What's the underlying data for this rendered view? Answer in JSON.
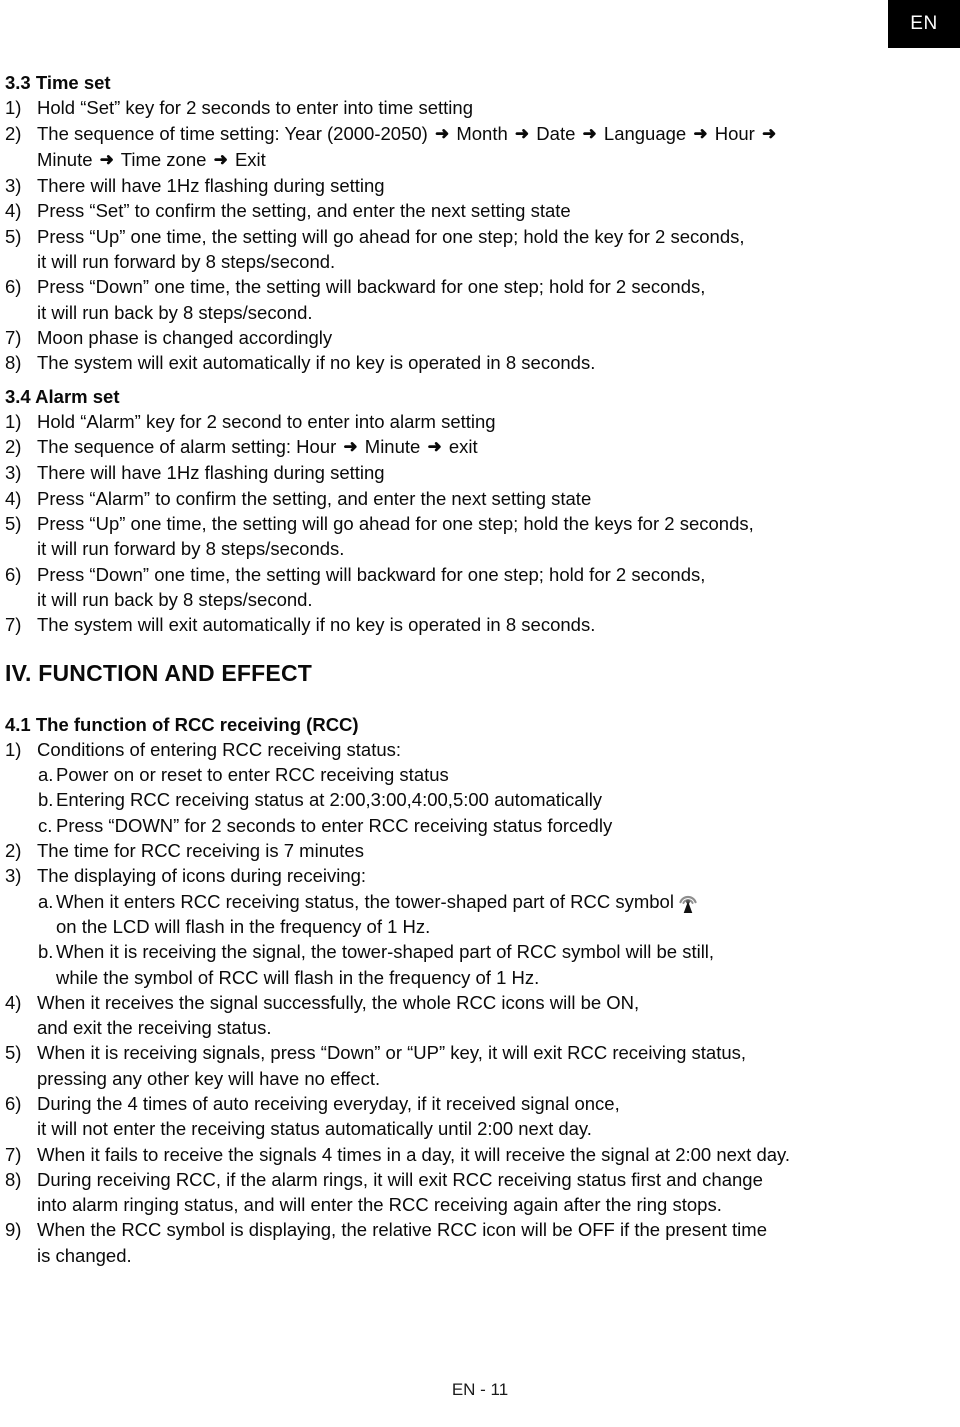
{
  "page": {
    "language_tab": "EN",
    "footer": "EN - 11"
  },
  "icons": {
    "arrow": "➜",
    "rcc_tower": "rcc-tower-icon"
  },
  "sections": [
    {
      "id": "3.3",
      "heading": "3.3 Time set",
      "items": [
        {
          "marker": "1)",
          "lines": [
            "Hold “Set” key for 2 seconds to enter into time setting"
          ]
        },
        {
          "marker": "2)",
          "lines": [
            "The sequence of time setting: Year (2000-2050) ➜ Month ➜ Date ➜ Language ➜ Hour ➜",
            "Minute ➜ Time zone ➜ Exit"
          ]
        },
        {
          "marker": "3)",
          "lines": [
            "There will have 1Hz flashing during setting"
          ]
        },
        {
          "marker": "4)",
          "lines": [
            "Press “Set” to confirm the setting, and enter the next setting state"
          ]
        },
        {
          "marker": "5)",
          "lines": [
            "Press “Up” one time, the setting will go ahead for one step; hold the key for 2 seconds,",
            "it will run forward by 8 steps/second."
          ]
        },
        {
          "marker": "6)",
          "lines": [
            "Press “Down” one time, the setting will backward for one step; hold for 2 seconds,",
            "it will run back by 8 steps/second."
          ]
        },
        {
          "marker": "7)",
          "lines": [
            "Moon phase is changed accordingly"
          ]
        },
        {
          "marker": "8)",
          "lines": [
            "The system will exit automatically if no key is operated in 8 seconds."
          ]
        }
      ]
    },
    {
      "id": "3.4",
      "heading": "3.4 Alarm set",
      "items": [
        {
          "marker": "1)",
          "lines": [
            "Hold “Alarm” key for 2 second to enter into alarm setting"
          ]
        },
        {
          "marker": "2)",
          "lines": [
            "The sequence of alarm setting: Hour ➜ Minute ➜ exit"
          ]
        },
        {
          "marker": "3)",
          "lines": [
            "There will have 1Hz flashing during setting"
          ]
        },
        {
          "marker": "4)",
          "lines": [
            "Press “Alarm” to confirm the setting, and enter the next setting state"
          ]
        },
        {
          "marker": "5)",
          "lines": [
            "Press “Up” one time, the setting will go ahead for one step; hold the keys for 2 seconds,",
            "it will run forward by 8 steps/seconds."
          ]
        },
        {
          "marker": "6)",
          "lines": [
            "Press “Down” one time, the setting will backward for one step; hold for 2 seconds,",
            "it will run back by 8 steps/second."
          ]
        },
        {
          "marker": "7)",
          "lines": [
            "The system will exit automatically if no key is operated in 8 seconds."
          ]
        }
      ]
    }
  ],
  "chapter": {
    "heading": "IV. FUNCTION AND EFFECT"
  },
  "section_41": {
    "heading": "4.1 The function of RCC receiving (RCC)",
    "items": [
      {
        "marker": "1)",
        "lines": [
          "Conditions of entering RCC receiving status:"
        ],
        "sub": [
          {
            "marker": "a.",
            "lines": [
              "Power on or reset to enter RCC receiving status"
            ]
          },
          {
            "marker": "b.",
            "lines": [
              "Entering RCC receiving status at 2:00,3:00,4:00,5:00 automatically"
            ]
          },
          {
            "marker": "c.",
            "lines": [
              "Press “DOWN” for 2 seconds to enter RCC receiving status forcedly"
            ]
          }
        ]
      },
      {
        "marker": "2)",
        "lines": [
          "The time for RCC receiving is 7 minutes"
        ]
      },
      {
        "marker": "3)",
        "lines": [
          "The displaying of icons during receiving:"
        ],
        "sub": [
          {
            "marker": "a.",
            "lines": [
              "When it enters RCC receiving status, the tower-shaped part of RCC symbol",
              "on the LCD will flash in the frequency of 1 Hz."
            ],
            "icon_after_first_line": "rcc-tower"
          },
          {
            "marker": "b.",
            "lines": [
              "When it is receiving the signal, the tower-shaped part of RCC symbol will be still,",
              "while the symbol of RCC will flash in the frequency of 1 Hz."
            ]
          }
        ]
      },
      {
        "marker": "4)",
        "lines": [
          "When it receives the signal successfully, the whole RCC icons will be ON,",
          "and exit the receiving status."
        ]
      },
      {
        "marker": "5)",
        "lines": [
          "When it is receiving signals, press “Down” or “UP” key, it will exit RCC receiving status,",
          "pressing any other key will have no effect."
        ]
      },
      {
        "marker": "6)",
        "lines": [
          "During the 4 times of auto receiving everyday, if it received signal once,",
          "it will not enter the receiving status automatically until 2:00 next day."
        ]
      },
      {
        "marker": "7)",
        "lines": [
          "When it fails to receive the signals 4 times in a day, it will receive the signal at 2:00 next day."
        ]
      },
      {
        "marker": "8)",
        "lines": [
          "During receiving RCC, if the alarm rings, it will exit RCC receiving status first and change",
          "into alarm ringing status, and will enter the RCC receiving again after the ring stops."
        ]
      },
      {
        "marker": "9)",
        "lines": [
          "When the RCC symbol is displaying, the relative RCC icon will be OFF if the present time",
          "is changed."
        ]
      }
    ]
  }
}
